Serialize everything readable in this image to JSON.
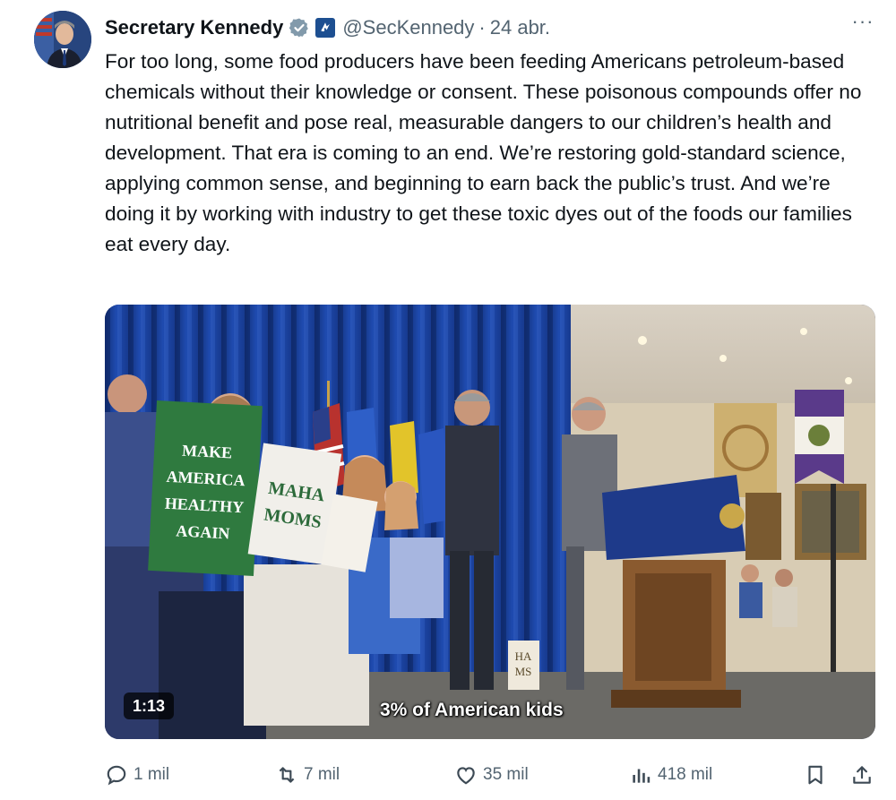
{
  "author": {
    "display_name": "Secretary Kennedy",
    "handle": "@SecKennedy",
    "separator": "·",
    "date": "24 abr.",
    "verified_icon": "verified-badge-icon",
    "affiliation_icon": "government-affiliation-icon"
  },
  "more_menu": "···",
  "tweet": {
    "text": "For too long, some food producers have been feeding Americans petroleum-based chemicals without their knowledge or consent. These poisonous compounds offer no nutritional benefit and pose real, measurable dangers to our children’s health and development. That era is coming to an end. We’re restoring gold-standard science, applying common sense, and beginning to earn back the public’s trust. And we’re doing it by working with industry to get these toxic dyes out of the foods our families eat every day."
  },
  "media": {
    "type": "video",
    "duration": "1:13",
    "caption": "3% of American kids",
    "sign_green": [
      "MAKE",
      "AMERICA",
      "HEALTHY",
      "AGAIN"
    ],
    "sign_white": [
      "MAHA",
      "MOMS"
    ],
    "sign_small": [
      "HA",
      "MS"
    ]
  },
  "actions": {
    "reply": "1 mil",
    "retweet": "7 mil",
    "like": "35 mil",
    "views": "418 mil"
  },
  "colors": {
    "text": "#0f1419",
    "muted": "#536471",
    "verified_gray": "#829aab"
  }
}
